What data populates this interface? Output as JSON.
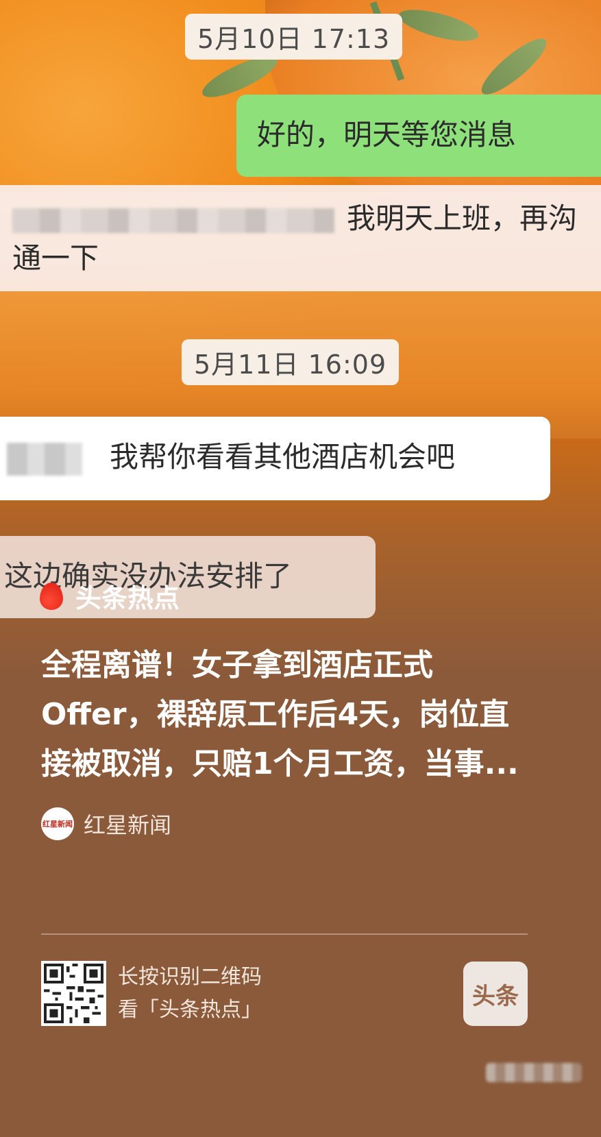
{
  "chat": {
    "timestamp_1": "5月10日 17:13",
    "msg_sent": "好的，明天等您消息",
    "msg_received_1": "我明天上班，再沟通一下",
    "timestamp_2": "5月11日 16:09",
    "msg_received_2": "我帮你看看其他酒店机会吧",
    "msg_received_3": "这边确实没办法安排了"
  },
  "card": {
    "topic_label": "头条热点",
    "headline": "全程离谱！女子拿到酒店正式Offer，裸辞原工作后4天，岗位直接被取消，只赔1个月工资，当事...",
    "source_name": "红星新闻",
    "source_logo_text": "红星新闻"
  },
  "footer": {
    "qr_line1": "长按识别二维码",
    "qr_line2": "看「头条热点」",
    "brand_label": "头条"
  },
  "colors": {
    "background": "#8a5a3b",
    "sent_bubble": "#8ee07a",
    "topic_icon": "#e62a1b"
  },
  "icons": {
    "topic": "flame-icon",
    "qr": "qr-code-icon"
  }
}
